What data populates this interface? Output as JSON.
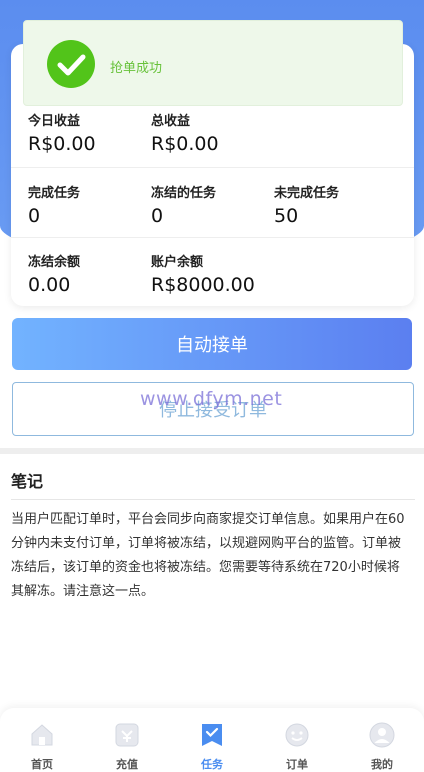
{
  "toast": {
    "message": "抢单成功",
    "icon": "check-circle-icon",
    "color": "#52c41a"
  },
  "stats": {
    "today_earnings": {
      "label": "今日收益",
      "value": "R$0.00"
    },
    "total_earnings": {
      "label": "总收益",
      "value": "R$0.00"
    },
    "completed_tasks": {
      "label": "完成任务",
      "value": "0"
    },
    "frozen_tasks": {
      "label": "冻结的任务",
      "value": "0"
    },
    "uncompleted_tasks": {
      "label": "未完成任务",
      "value": "50"
    },
    "frozen_balance": {
      "label": "冻结余额",
      "value": "0.00"
    },
    "account_balance": {
      "label": "账户余额",
      "value": "R$8000.00"
    }
  },
  "actions": {
    "auto_accept": "自动接单",
    "stop_accept": "停止接受订单"
  },
  "watermark": "www.dfym.net",
  "notes": {
    "title": "笔记",
    "body": "当用户匹配订单时，平台会同步向商家提交订单信息。如果用户在60分钟内未支付订单，订单将被冻结，以规避网购平台的监管。订单被冻结后，该订单的资金也将被冻结。您需要等待系统在720小时候将其解冻。请注意这一点。"
  },
  "tabbar": {
    "items": [
      {
        "label": "首页",
        "icon": "home-icon"
      },
      {
        "label": "充值",
        "icon": "recharge-icon"
      },
      {
        "label": "任务",
        "icon": "task-icon"
      },
      {
        "label": "订单",
        "icon": "order-icon"
      },
      {
        "label": "我的",
        "icon": "profile-icon"
      }
    ],
    "active_index": 2,
    "active_color": "#4a8df0"
  },
  "colors": {
    "header_blue": "#5b8def",
    "button_gradient_start": "#72b3ff",
    "button_gradient_end": "#5b7ff0"
  }
}
